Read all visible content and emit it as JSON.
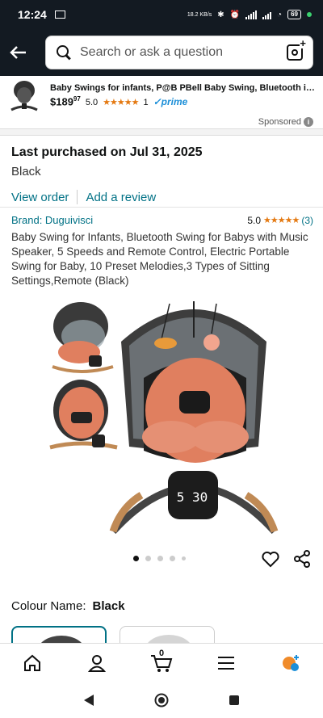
{
  "status_bar": {
    "time": "12:24",
    "speed": "18.2 KB/s",
    "battery": "69"
  },
  "search": {
    "placeholder": "Search or ask a question"
  },
  "sponsored_ad": {
    "title": "Baby Swings for infants, P@B PBell Baby Swing, Bluetooth infa...",
    "price_whole": "$189",
    "price_fraction": "97",
    "rating": "5.0",
    "stars": "★★★★★",
    "review_count": "1",
    "prime": "✓prime",
    "sponsored_label": "Sponsored"
  },
  "purchase": {
    "title": "Last purchased on Jul 31, 2025",
    "variant": "Black",
    "view_order": "View order",
    "add_review": "Add a review"
  },
  "product": {
    "brand": "Brand: Duguivisci",
    "rating": "5.0",
    "stars": "★★★★★",
    "review_count": "(3)",
    "title": "Baby Swing for Infants, Bluetooth Swing for Babys with Music Speaker, 5 Speeds and Remote Control, Electric Portable Swing for Baby, 10 Preset Melodies,3 Types of Sitting Settings,Remote (Black)",
    "display_time": "5 30",
    "image_count": 5,
    "active_image": 1
  },
  "colour": {
    "label": "Colour Name:",
    "value": "Black"
  },
  "bottom_nav": {
    "cart_count": "0"
  },
  "colors": {
    "header_bg": "#131a22",
    "link": "#007185",
    "star": "#e47911",
    "prime": "#1c8fd8",
    "cushion": "#e07f5f",
    "frame": "#3a3a3a",
    "wood": "#c08a55"
  }
}
